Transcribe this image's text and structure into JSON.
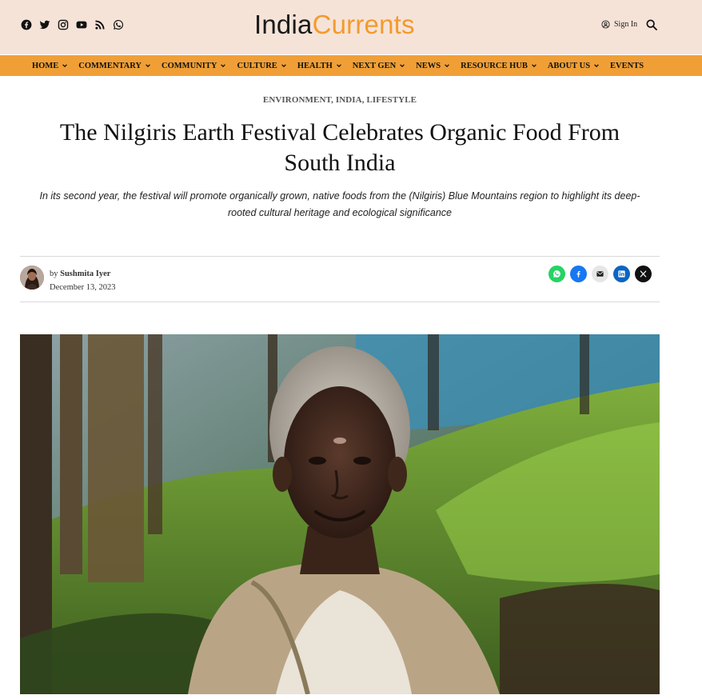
{
  "brand": {
    "name_part1": "India",
    "name_part2": "Currents",
    "accent_color": "#f39a2c",
    "header_bg": "#f6e3d8",
    "nav_bg": "#f09f36"
  },
  "social_icons": [
    "facebook-icon",
    "twitter-icon",
    "instagram-icon",
    "youtube-icon",
    "rss-icon",
    "whatsapp-icon"
  ],
  "header": {
    "signin_label": "Sign In",
    "search_icon": "search-icon"
  },
  "nav": {
    "items": [
      {
        "label": "HOME",
        "has_dropdown": true
      },
      {
        "label": "COMMENTARY",
        "has_dropdown": true
      },
      {
        "label": "COMMUNITY",
        "has_dropdown": true
      },
      {
        "label": "CULTURE",
        "has_dropdown": true
      },
      {
        "label": "HEALTH",
        "has_dropdown": true
      },
      {
        "label": "NEXT GEN",
        "has_dropdown": true
      },
      {
        "label": "NEWS",
        "has_dropdown": true
      },
      {
        "label": "RESOURCE HUB",
        "has_dropdown": true
      },
      {
        "label": "ABOUT US",
        "has_dropdown": true
      },
      {
        "label": "EVENTS",
        "has_dropdown": false
      }
    ]
  },
  "article": {
    "categories": [
      "ENVIRONMENT",
      "INDIA",
      "LIFESTYLE"
    ],
    "categories_sep": ", ",
    "title": "The Nilgiris Earth Festival Celebrates Organic Food From South India",
    "subtitle": "In its second year, the festival will promote organically grown, native foods from the (Nilgiris) Blue Mountains region to highlight its deep-rooted cultural heritage and ecological significance",
    "byline_prefix": "by",
    "author": "Sushmita Iyer",
    "date": "December 13, 2023",
    "share_buttons": [
      {
        "icon": "whatsapp-icon",
        "color": "#25d366"
      },
      {
        "icon": "facebook-icon",
        "color": "#1877f2"
      },
      {
        "icon": "email-icon",
        "color": "#e6e6e6"
      },
      {
        "icon": "linkedin-icon",
        "color": "#0a66c2"
      },
      {
        "icon": "x-icon",
        "color": "#111111"
      }
    ]
  }
}
